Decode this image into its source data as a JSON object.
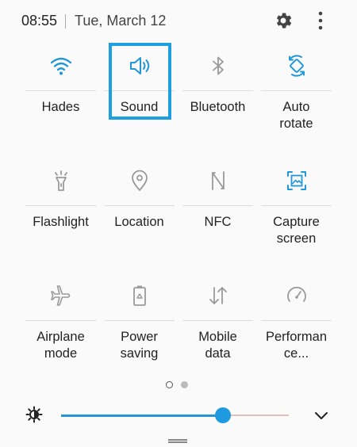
{
  "status": {
    "time": "08:55",
    "date": "Tue, March 12"
  },
  "colors": {
    "accent": "#1f9ae0",
    "icon_active": "#2196d8",
    "icon_inactive": "#9a9a9a"
  },
  "tiles": [
    {
      "label": "Hades",
      "icon": "wifi-icon",
      "active": true
    },
    {
      "label": "Sound",
      "icon": "speaker-icon",
      "active": true
    },
    {
      "label": "Bluetooth",
      "icon": "bluetooth-icon",
      "active": false
    },
    {
      "label": "Auto\nrotate",
      "icon": "auto-rotate-icon",
      "active": true
    },
    {
      "label": "Flashlight",
      "icon": "flashlight-icon",
      "active": false
    },
    {
      "label": "Location",
      "icon": "location-pin-icon",
      "active": false
    },
    {
      "label": "NFC",
      "icon": "nfc-icon",
      "active": false
    },
    {
      "label": "Capture\nscreen",
      "icon": "screenshot-icon",
      "active": true
    },
    {
      "label": "Airplane\nmode",
      "icon": "airplane-icon",
      "active": false
    },
    {
      "label": "Power\nsaving",
      "icon": "battery-icon",
      "active": false
    },
    {
      "label": "Mobile\ndata",
      "icon": "data-arrows-icon",
      "active": false
    },
    {
      "label": "Performan\nce...",
      "icon": "speedometer-icon",
      "active": false
    }
  ],
  "pager": {
    "current": 1,
    "total": 2
  },
  "brightness": {
    "level": 0.71,
    "icon": "brightness-icon"
  }
}
